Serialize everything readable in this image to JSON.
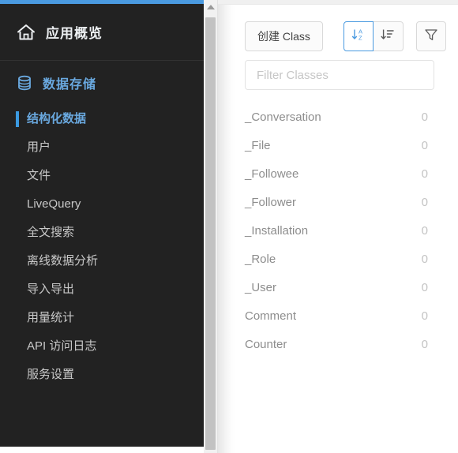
{
  "theme": {
    "accent": "#4a9ae0",
    "sidebar_bg": "#222222",
    "active_blue": "#6aa9e0",
    "panel_bg": "#ffffff"
  },
  "sidebar": {
    "brand": {
      "icon": "home-icon",
      "title": "应用概览"
    },
    "section": {
      "icon": "database-icon",
      "label": "数据存储"
    },
    "items": [
      {
        "label": "结构化数据",
        "active": true
      },
      {
        "label": "用户",
        "active": false
      },
      {
        "label": "文件",
        "active": false
      },
      {
        "label": "LiveQuery",
        "active": false
      },
      {
        "label": "全文搜索",
        "active": false
      },
      {
        "label": "离线数据分析",
        "active": false
      },
      {
        "label": "导入导出",
        "active": false
      },
      {
        "label": "用量统计",
        "active": false
      },
      {
        "label": "API 访问日志",
        "active": false
      },
      {
        "label": "服务设置",
        "active": false
      }
    ]
  },
  "scrollbar": {
    "up_arrow": "scroll-up-arrow-icon"
  },
  "panel": {
    "toolbar": {
      "create_class_label": "创建 Class",
      "sort_alpha_icon": "sort-alphabetical-icon",
      "sort_alpha_selected": true,
      "sort_order_icon": "sort-descending-icon",
      "filter_icon": "funnel-filter-icon"
    },
    "filter": {
      "value": "",
      "placeholder": "Filter Classes"
    },
    "classes": [
      {
        "name": "_Conversation",
        "count": "0"
      },
      {
        "name": "_File",
        "count": "0"
      },
      {
        "name": "_Followee",
        "count": "0"
      },
      {
        "name": "_Follower",
        "count": "0"
      },
      {
        "name": "_Installation",
        "count": "0"
      },
      {
        "name": "_Role",
        "count": "0"
      },
      {
        "name": "_User",
        "count": "0"
      },
      {
        "name": "Comment",
        "count": "0"
      },
      {
        "name": "Counter",
        "count": "0"
      }
    ]
  }
}
